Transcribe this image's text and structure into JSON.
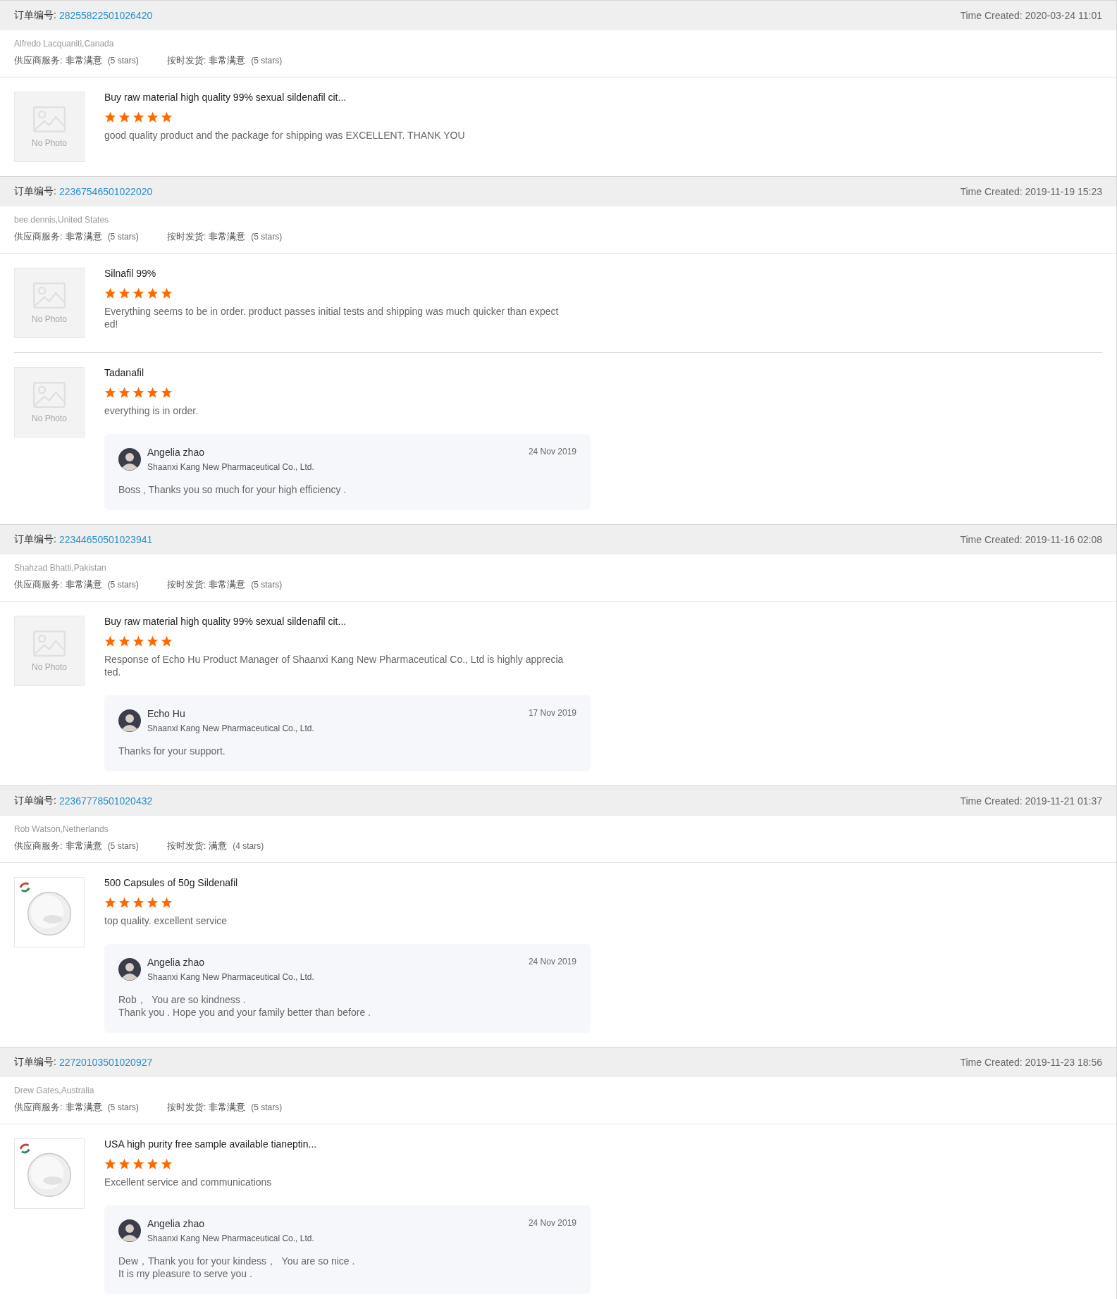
{
  "orders": [
    {
      "label": "订单编号:",
      "number": "28255822501026420",
      "time": "Time Created: 2020-03-24 11:01",
      "buyer": "Alfredo Lacquaniti,Canada",
      "ratings": [
        {
          "label": "供应商服务:",
          "value": "非常满意",
          "stars_text": "(5 stars)"
        },
        {
          "label": "按时发货:",
          "value": "非常满意",
          "stars_text": "(5 stars)"
        }
      ],
      "products": [
        {
          "thumb": {
            "kind": "placeholder",
            "label": "No Photo"
          },
          "title": "Buy raw material high quality 99% sexual sildenafil cit...",
          "stars": 5,
          "review": "good quality product and the package for shipping was EXCELLENT. THANK YOU"
        }
      ]
    },
    {
      "label": "订单编号:",
      "number": "22367546501022020",
      "time": "Time Created: 2019-11-19 15:23",
      "buyer": "bee dennis,United States",
      "ratings": [
        {
          "label": "供应商服务:",
          "value": "非常满意",
          "stars_text": "(5 stars)"
        },
        {
          "label": "按时发货:",
          "value": "非常满意",
          "stars_text": "(5 stars)"
        }
      ],
      "products": [
        {
          "thumb": {
            "kind": "placeholder",
            "label": "No Photo"
          },
          "title": "Silnafil 99%",
          "stars": 5,
          "review": "Everything seems to be in order. product passes initial tests and shipping was much quicker than expected!"
        },
        {
          "thumb": {
            "kind": "placeholder",
            "label": "No Photo"
          },
          "title": "Tadanafil",
          "stars": 5,
          "review": "everything is in order.",
          "reply": {
            "name": "Angelia zhao",
            "company": "Shaanxi Kang New Pharmaceutical Co., Ltd.",
            "date": "24 Nov 2019",
            "lines": [
              "Boss , Thanks you so much for your high efficiency ."
            ]
          }
        }
      ]
    },
    {
      "label": "订单编号:",
      "number": "22344650501023941",
      "time": "Time Created: 2019-11-16 02:08",
      "buyer": "Shahzad Bhatti,Pakistan",
      "ratings": [
        {
          "label": "供应商服务:",
          "value": "非常满意",
          "stars_text": "(5 stars)"
        },
        {
          "label": "按时发货:",
          "value": "非常满意",
          "stars_text": "(5 stars)"
        }
      ],
      "products": [
        {
          "thumb": {
            "kind": "placeholder",
            "label": "No Photo"
          },
          "title": "Buy raw material high quality 99% sexual sildenafil cit...",
          "stars": 5,
          "review": "Response of Echo Hu Product Manager of Shaanxi Kang New Pharmaceutical Co., Ltd is highly appreciated.",
          "reply": {
            "name": "Echo Hu",
            "company": "Shaanxi Kang New Pharmaceutical Co., Ltd.",
            "date": "17 Nov 2019",
            "lines": [
              "Thanks for your support."
            ]
          }
        }
      ]
    },
    {
      "label": "订单编号:",
      "number": "22367778501020432",
      "time": "Time Created: 2019-11-21 01:37",
      "buyer": "Rob Watson,Netherlands",
      "ratings": [
        {
          "label": "供应商服务:",
          "value": "非常满意",
          "stars_text": "(5 stars)"
        },
        {
          "label": "按时发货:",
          "value": "满意",
          "stars_text": "(4 stars)"
        }
      ],
      "products": [
        {
          "title": "500 Capsules of 50g Sildenafil",
          "stars": 5,
          "review": "top quality.  excellent service",
          "reply": {
            "name": "Angelia zhao",
            "company": "Shaanxi Kang New Pharmaceutical Co., Ltd.",
            "date": "24 Nov 2019",
            "lines": [
              "Rob，  You are so kindness .",
              "Thank you . Hope you and your family better than before ."
            ]
          }
        }
      ]
    },
    {
      "label": "订单编号:",
      "number": "22720103501020927",
      "time": "Time Created: 2019-11-23 18:56",
      "buyer": "Drew Gates,Australia",
      "ratings": [
        {
          "label": "供应商服务:",
          "value": "非常满意",
          "stars_text": "(5 stars)"
        },
        {
          "label": "按时发货:",
          "value": "非常满意",
          "stars_text": "(5 stars)"
        }
      ],
      "products": [
        {
          "title": "USA high purity free sample available tianeptin...",
          "stars": 5,
          "review": "Excellent service and communications",
          "reply": {
            "name": "Angelia zhao",
            "company": "Shaanxi Kang New Pharmaceutical Co., Ltd.",
            "date": "24 Nov 2019",
            "lines": [
              "Dew，Thank you for your kindess，  You are so nice .",
              "It is my pleasure to serve you ."
            ]
          }
        }
      ]
    }
  ]
}
